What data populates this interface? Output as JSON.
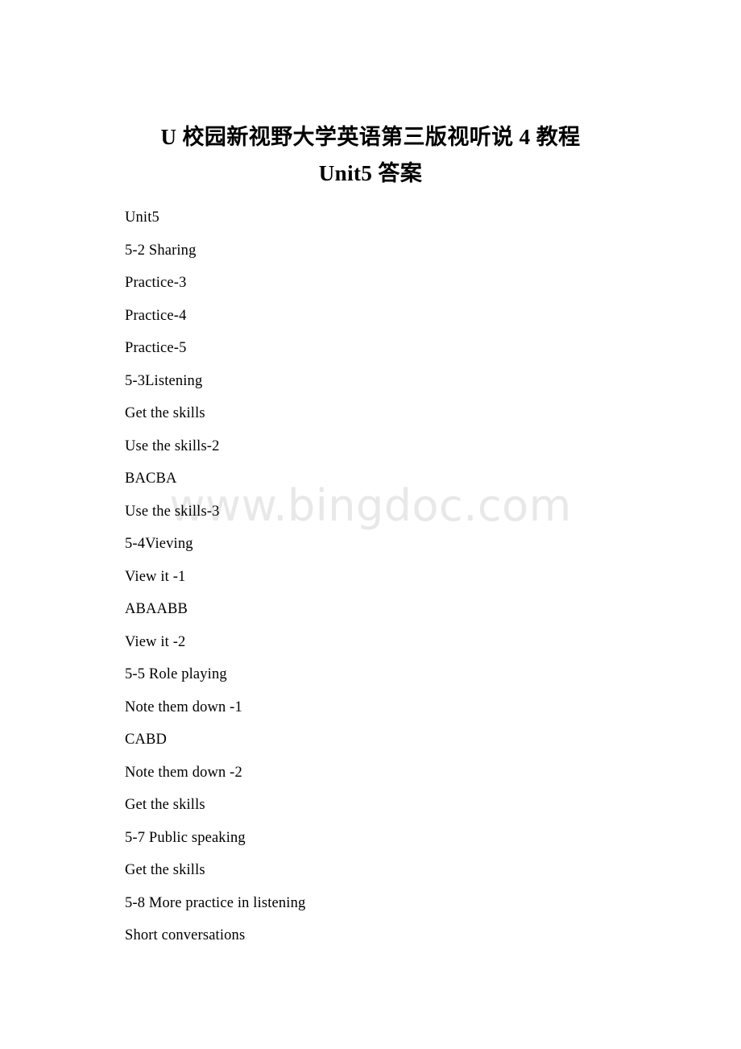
{
  "document": {
    "background_color": "#ffffff",
    "text_color": "#000000",
    "title": {
      "line1": "U 校园新视野大学英语第三版视听说 4 教程",
      "line2": "Unit5 答案"
    },
    "watermark": {
      "text": "www.bingdoc.com",
      "color": "#e8e8e8"
    },
    "body_lines": [
      "Unit5",
      "5-2 Sharing",
      "Practice-3",
      "Practice-4",
      "Practice-5",
      "5-3Listening",
      "Get the skills",
      "Use the skills-2",
      "BACBA",
      "Use the skills-3",
      "5-4Vieving",
      "View it -1",
      "ABAABB",
      "View it -2",
      "5-5 Role playing",
      "Note them down -1",
      "CABD",
      "Note them down -2",
      "Get the skills",
      "5-7 Public speaking",
      "Get the skills",
      "5-8 More practice in listening",
      "Short conversations"
    ]
  }
}
